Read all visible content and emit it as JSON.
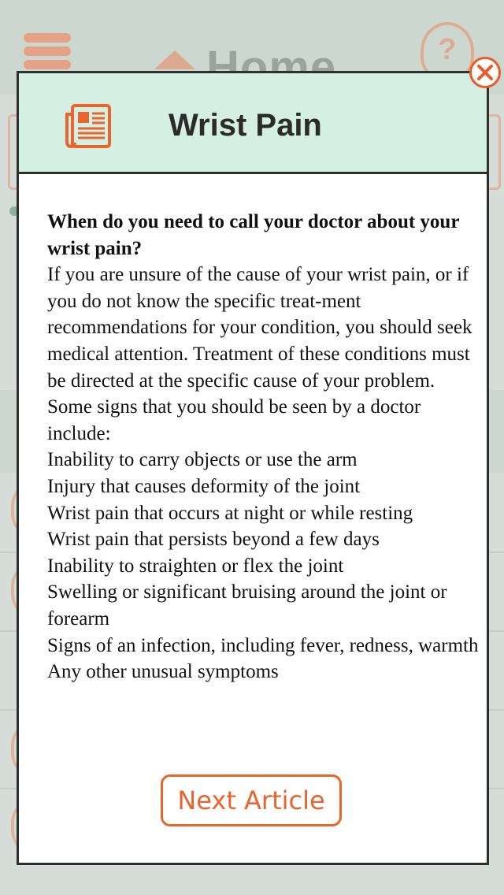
{
  "background": {
    "title": "Home"
  },
  "modal": {
    "title": "Wrist Pain",
    "icon": "newspaper-icon",
    "close_icon": "close-icon",
    "question": "When do you need to call your doctor about your wrist pain?",
    "paragraph": "If you are unsure of the cause of your wrist pain, or if you do not know the specific treat-ment recommendations for your condition, you should seek medical attention. Treatment of these conditions must be directed at the specific cause of your problem. Some signs that you should be seen by a doctor include:",
    "signs": [
      "Inability to carry objects or use the arm",
      "Injury that causes deformity of the joint",
      "Wrist pain that occurs at night or while resting",
      "Wrist pain that persists beyond a few days",
      "Inability to straighten or flex the joint",
      "Swelling or significant bruising around the joint or forearm",
      "Signs of an infection, including fever, redness, warmth",
      "Any other unusual symptoms"
    ],
    "next_button_label": "Next Article"
  },
  "colors": {
    "accent": "#e8652d",
    "header_bg": "#d4efe3",
    "text": "#111111"
  }
}
